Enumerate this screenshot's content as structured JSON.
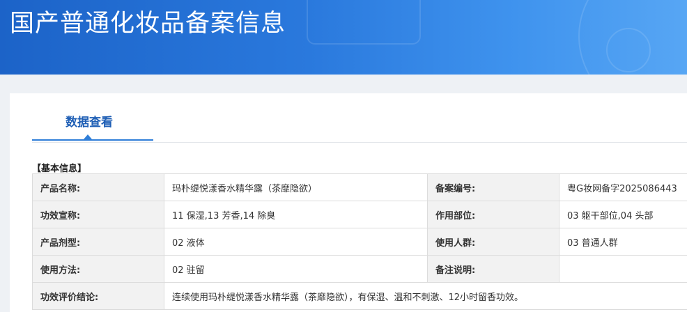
{
  "header": {
    "title": "国产普通化妆品备案信息"
  },
  "tabs": [
    {
      "label": "数据查看",
      "active": true
    }
  ],
  "section": {
    "title": "【基本信息】"
  },
  "info": {
    "product_name_label": "产品名称:",
    "product_name": "玛朴缇悦漾香水精华露（茶靡隐欲）",
    "record_no_label": "备案编号:",
    "record_no": "粤G妆网备字2025086443",
    "efficacy_label": "功效宣称:",
    "efficacy": "11 保湿,13 芳香,14 除臭",
    "area_label": "作用部位:",
    "area": "03 躯干部位,04 头部",
    "form_label": "产品剂型:",
    "form": "02 液体",
    "users_label": "使用人群:",
    "users": "03 普通人群",
    "usage_label": "使用方法:",
    "usage": "02 驻留",
    "remarks_label": "备注说明:",
    "remarks": "",
    "conclusion_label": "功效评价结论:",
    "conclusion": "连续使用玛朴缇悦漾香水精华露（茶靡隐欲），有保湿、温和不刺激、12小时留香功效。"
  },
  "colors": {
    "banner": "#2a79dd",
    "tab_accent": "#2f7ed8",
    "tab_text": "#1f5fb5",
    "label_bg": "#f2f2f2",
    "border": "#dcdcdc"
  }
}
